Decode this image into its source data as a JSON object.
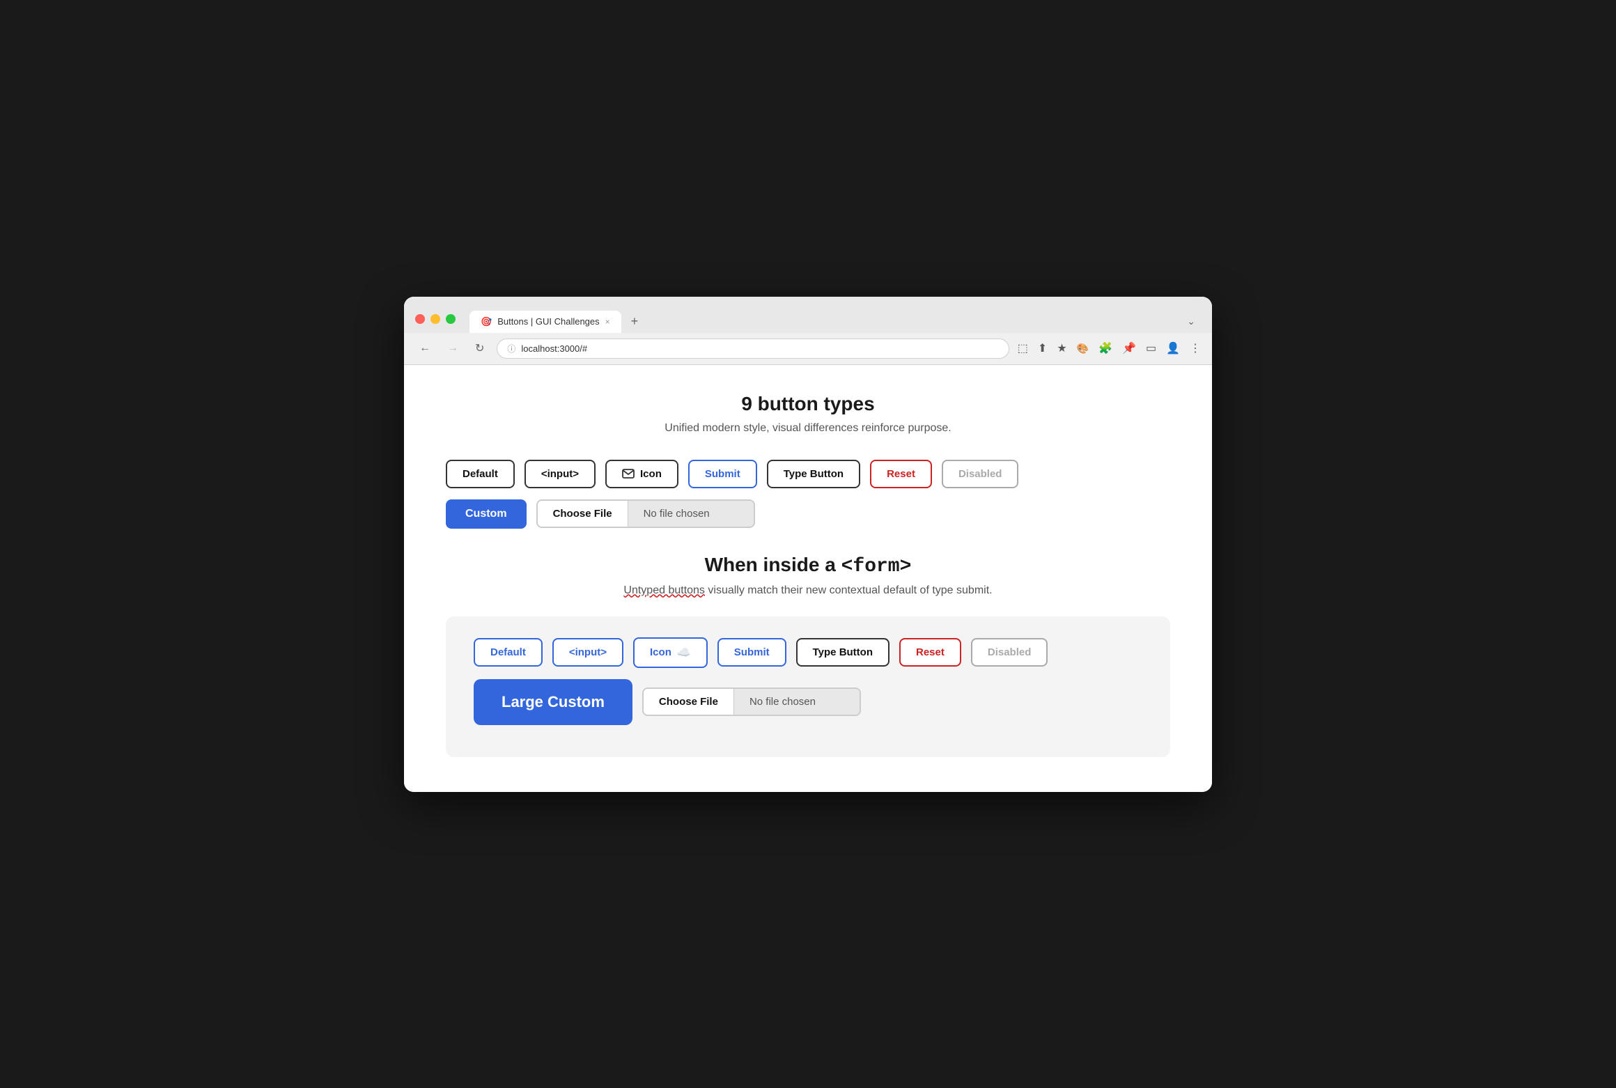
{
  "browser": {
    "traffic_lights": [
      "close",
      "minimize",
      "maximize"
    ],
    "tab_label": "Buttons | GUI Challenges",
    "tab_close": "×",
    "new_tab": "+",
    "url": "localhost:3000/#",
    "nav_back": "←",
    "nav_forward": "→",
    "nav_reload": "↻",
    "more_options": "⋮",
    "tab_expand": "⌄"
  },
  "section1": {
    "title": "9 button types",
    "subtitle": "Unified modern style, visual differences reinforce purpose.",
    "row1": {
      "default_label": "Default",
      "input_label": "<input>",
      "icon_label": "Icon",
      "submit_label": "Submit",
      "type_button_label": "Type Button",
      "reset_label": "Reset",
      "disabled_label": "Disabled"
    },
    "row2": {
      "custom_label": "Custom",
      "choose_file_label": "Choose File",
      "no_file_label": "No file chosen"
    }
  },
  "section2": {
    "title_prefix": "When inside a ",
    "title_code": "<form>",
    "subtitle_plain": " visually match their new contextual default of type submit.",
    "subtitle_underline": "Untyped buttons",
    "row1": {
      "default_label": "Default",
      "input_label": "<input>",
      "icon_label": "Icon",
      "submit_label": "Submit",
      "type_button_label": "Type Button",
      "reset_label": "Reset",
      "disabled_label": "Disabled"
    },
    "row2": {
      "large_custom_label": "Large Custom",
      "choose_file_label": "Choose File",
      "no_file_label": "No file chosen"
    }
  }
}
